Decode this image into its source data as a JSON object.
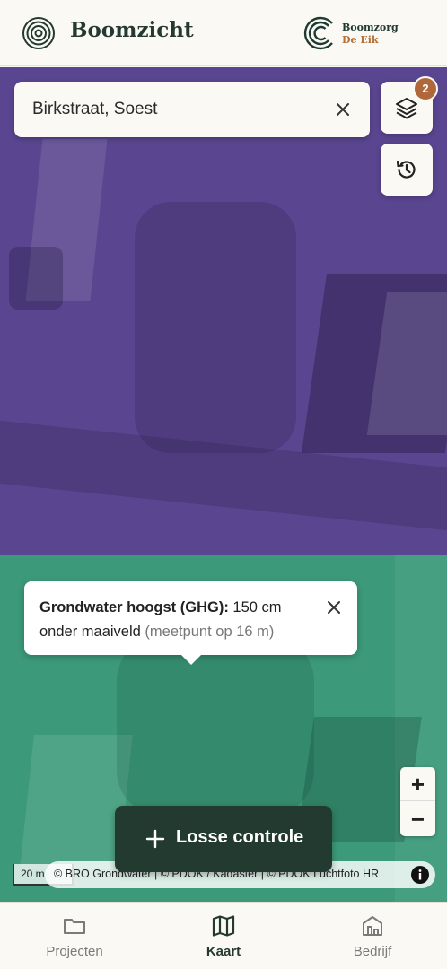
{
  "header": {
    "app_title": "Boomzicht",
    "brand_name_line1": "Boomzorg",
    "brand_name_line2": "De Eik"
  },
  "search": {
    "value": "Birkstraat, Soest",
    "clear_icon": "close-icon"
  },
  "map_controls": {
    "layers_icon": "layers-icon",
    "layers_badge": "2",
    "history_icon": "history-icon",
    "zoom_in_label": "+",
    "zoom_out_label": "−"
  },
  "popup": {
    "label": "Grondwater hoogst (GHG):",
    "value": " 150 cm onder maaiveld ",
    "note": "(meetpunt op 16 m)"
  },
  "scale": {
    "label": "20 m"
  },
  "attribution": {
    "text": "© BRO Grondwater | © PDOK / Kadaster | © PDOK Luchtfoto HR"
  },
  "action": {
    "label": "Losse controle"
  },
  "nav": {
    "items": [
      {
        "label": "Projecten",
        "icon": "folder-icon",
        "active": false
      },
      {
        "label": "Kaart",
        "icon": "map-icon",
        "active": true
      },
      {
        "label": "Bedrijf",
        "icon": "building-icon",
        "active": false
      }
    ]
  },
  "colors": {
    "primary": "#233a30",
    "accent": "#b0683a",
    "zone_high": "#5a4690",
    "zone_low": "#3c9a7a",
    "background": "#fbf9f4"
  }
}
